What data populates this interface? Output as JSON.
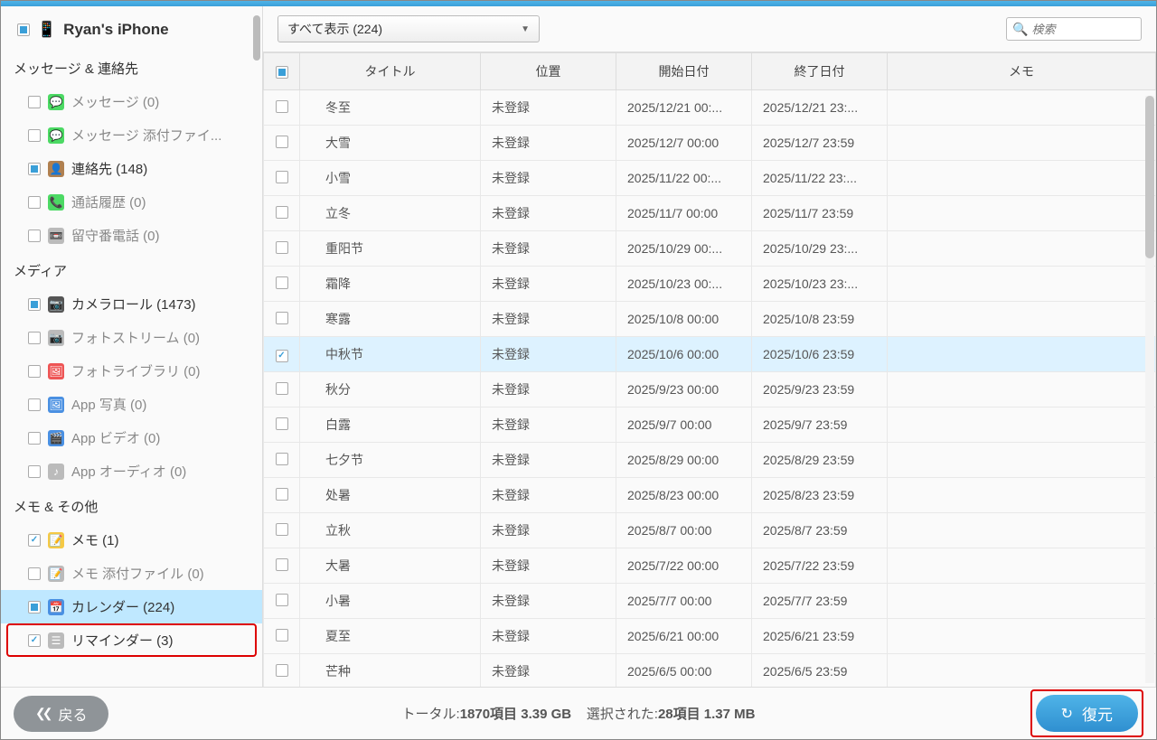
{
  "device_name": "Ryan's iPhone",
  "sections": {
    "messages": "メッセージ & 連絡先",
    "media": "メディア",
    "memo": "メモ & その他"
  },
  "sidebar": [
    {
      "label": "メッセージ (0)",
      "icon": "💬",
      "iconClass": "green",
      "active": false,
      "chk": ""
    },
    {
      "label": "メッセージ 添付ファイ...",
      "icon": "💬",
      "iconClass": "green",
      "active": false,
      "chk": ""
    },
    {
      "label": "連絡先 (148)",
      "icon": "👤",
      "iconClass": "brown",
      "active": true,
      "chk": "partial"
    },
    {
      "label": "通話履歴 (0)",
      "icon": "📞",
      "iconClass": "green",
      "active": false,
      "chk": ""
    },
    {
      "label": "留守番電話 (0)",
      "icon": "📼",
      "iconClass": "grey",
      "active": false,
      "chk": ""
    }
  ],
  "media_items": [
    {
      "label": "カメラロール (1473)",
      "icon": "📷",
      "iconClass": "dark",
      "active": true,
      "chk": "partial"
    },
    {
      "label": "フォトストリーム (0)",
      "icon": "📷",
      "iconClass": "grey",
      "active": false,
      "chk": ""
    },
    {
      "label": "フォトライブラリ (0)",
      "icon": "🖼",
      "iconClass": "red",
      "active": false,
      "chk": ""
    },
    {
      "label": "App 写真 (0)",
      "icon": "🖼",
      "iconClass": "blue",
      "active": false,
      "chk": ""
    },
    {
      "label": "App ビデオ (0)",
      "icon": "🎬",
      "iconClass": "blue",
      "active": false,
      "chk": ""
    },
    {
      "label": "App オーディオ (0)",
      "icon": "♪",
      "iconClass": "grey",
      "active": false,
      "chk": ""
    }
  ],
  "memo_items": [
    {
      "label": "メモ (1)",
      "icon": "📝",
      "iconClass": "yellow",
      "active": true,
      "chk": "checked"
    },
    {
      "label": "メモ 添付ファイル (0)",
      "icon": "📝",
      "iconClass": "grey",
      "active": false,
      "chk": ""
    },
    {
      "label": "カレンダー (224)",
      "icon": "📅",
      "iconClass": "blue",
      "active": true,
      "chk": "partial",
      "selected": true
    },
    {
      "label": "リマインダー (3)",
      "icon": "☰",
      "iconClass": "grey",
      "active": true,
      "chk": "checked",
      "highlight": true
    }
  ],
  "filter_label": "すべて表示 (224)",
  "search_placeholder": "検索",
  "columns": {
    "title": "タイトル",
    "location": "位置",
    "start": "開始日付",
    "end": "終了日付",
    "memo": "メモ"
  },
  "rows": [
    {
      "title": "冬至",
      "loc": "未登録",
      "start": "2025/12/21 00:...",
      "end": "2025/12/21 23:...",
      "chk": ""
    },
    {
      "title": "大雪",
      "loc": "未登録",
      "start": "2025/12/7 00:00",
      "end": "2025/12/7 23:59",
      "chk": ""
    },
    {
      "title": "小雪",
      "loc": "未登録",
      "start": "2025/11/22 00:...",
      "end": "2025/11/22 23:...",
      "chk": ""
    },
    {
      "title": "立冬",
      "loc": "未登録",
      "start": "2025/11/7 00:00",
      "end": "2025/11/7 23:59",
      "chk": ""
    },
    {
      "title": "重阳节",
      "loc": "未登録",
      "start": "2025/10/29 00:...",
      "end": "2025/10/29 23:...",
      "chk": ""
    },
    {
      "title": "霜降",
      "loc": "未登録",
      "start": "2025/10/23 00:...",
      "end": "2025/10/23 23:...",
      "chk": ""
    },
    {
      "title": "寒露",
      "loc": "未登録",
      "start": "2025/10/8 00:00",
      "end": "2025/10/8 23:59",
      "chk": ""
    },
    {
      "title": "中秋节",
      "loc": "未登録",
      "start": "2025/10/6 00:00",
      "end": "2025/10/6 23:59",
      "chk": "checked",
      "selected": true
    },
    {
      "title": "秋分",
      "loc": "未登録",
      "start": "2025/9/23 00:00",
      "end": "2025/9/23 23:59",
      "chk": ""
    },
    {
      "title": "白露",
      "loc": "未登録",
      "start": "2025/9/7 00:00",
      "end": "2025/9/7 23:59",
      "chk": ""
    },
    {
      "title": "七夕节",
      "loc": "未登録",
      "start": "2025/8/29 00:00",
      "end": "2025/8/29 23:59",
      "chk": ""
    },
    {
      "title": "处暑",
      "loc": "未登録",
      "start": "2025/8/23 00:00",
      "end": "2025/8/23 23:59",
      "chk": ""
    },
    {
      "title": "立秋",
      "loc": "未登録",
      "start": "2025/8/7 00:00",
      "end": "2025/8/7 23:59",
      "chk": ""
    },
    {
      "title": "大暑",
      "loc": "未登録",
      "start": "2025/7/22 00:00",
      "end": "2025/7/22 23:59",
      "chk": ""
    },
    {
      "title": "小暑",
      "loc": "未登録",
      "start": "2025/7/7 00:00",
      "end": "2025/7/7 23:59",
      "chk": ""
    },
    {
      "title": "夏至",
      "loc": "未登録",
      "start": "2025/6/21 00:00",
      "end": "2025/6/21 23:59",
      "chk": ""
    },
    {
      "title": "芒种",
      "loc": "未登録",
      "start": "2025/6/5 00:00",
      "end": "2025/6/5 23:59",
      "chk": ""
    }
  ],
  "footer": {
    "back": "戻る",
    "stats_total_label": "トータル:",
    "stats_total_value": "1870項目 3.39 GB",
    "stats_sel_label": "選択された:",
    "stats_sel_value": "28項目 1.37 MB",
    "restore": "復元"
  }
}
